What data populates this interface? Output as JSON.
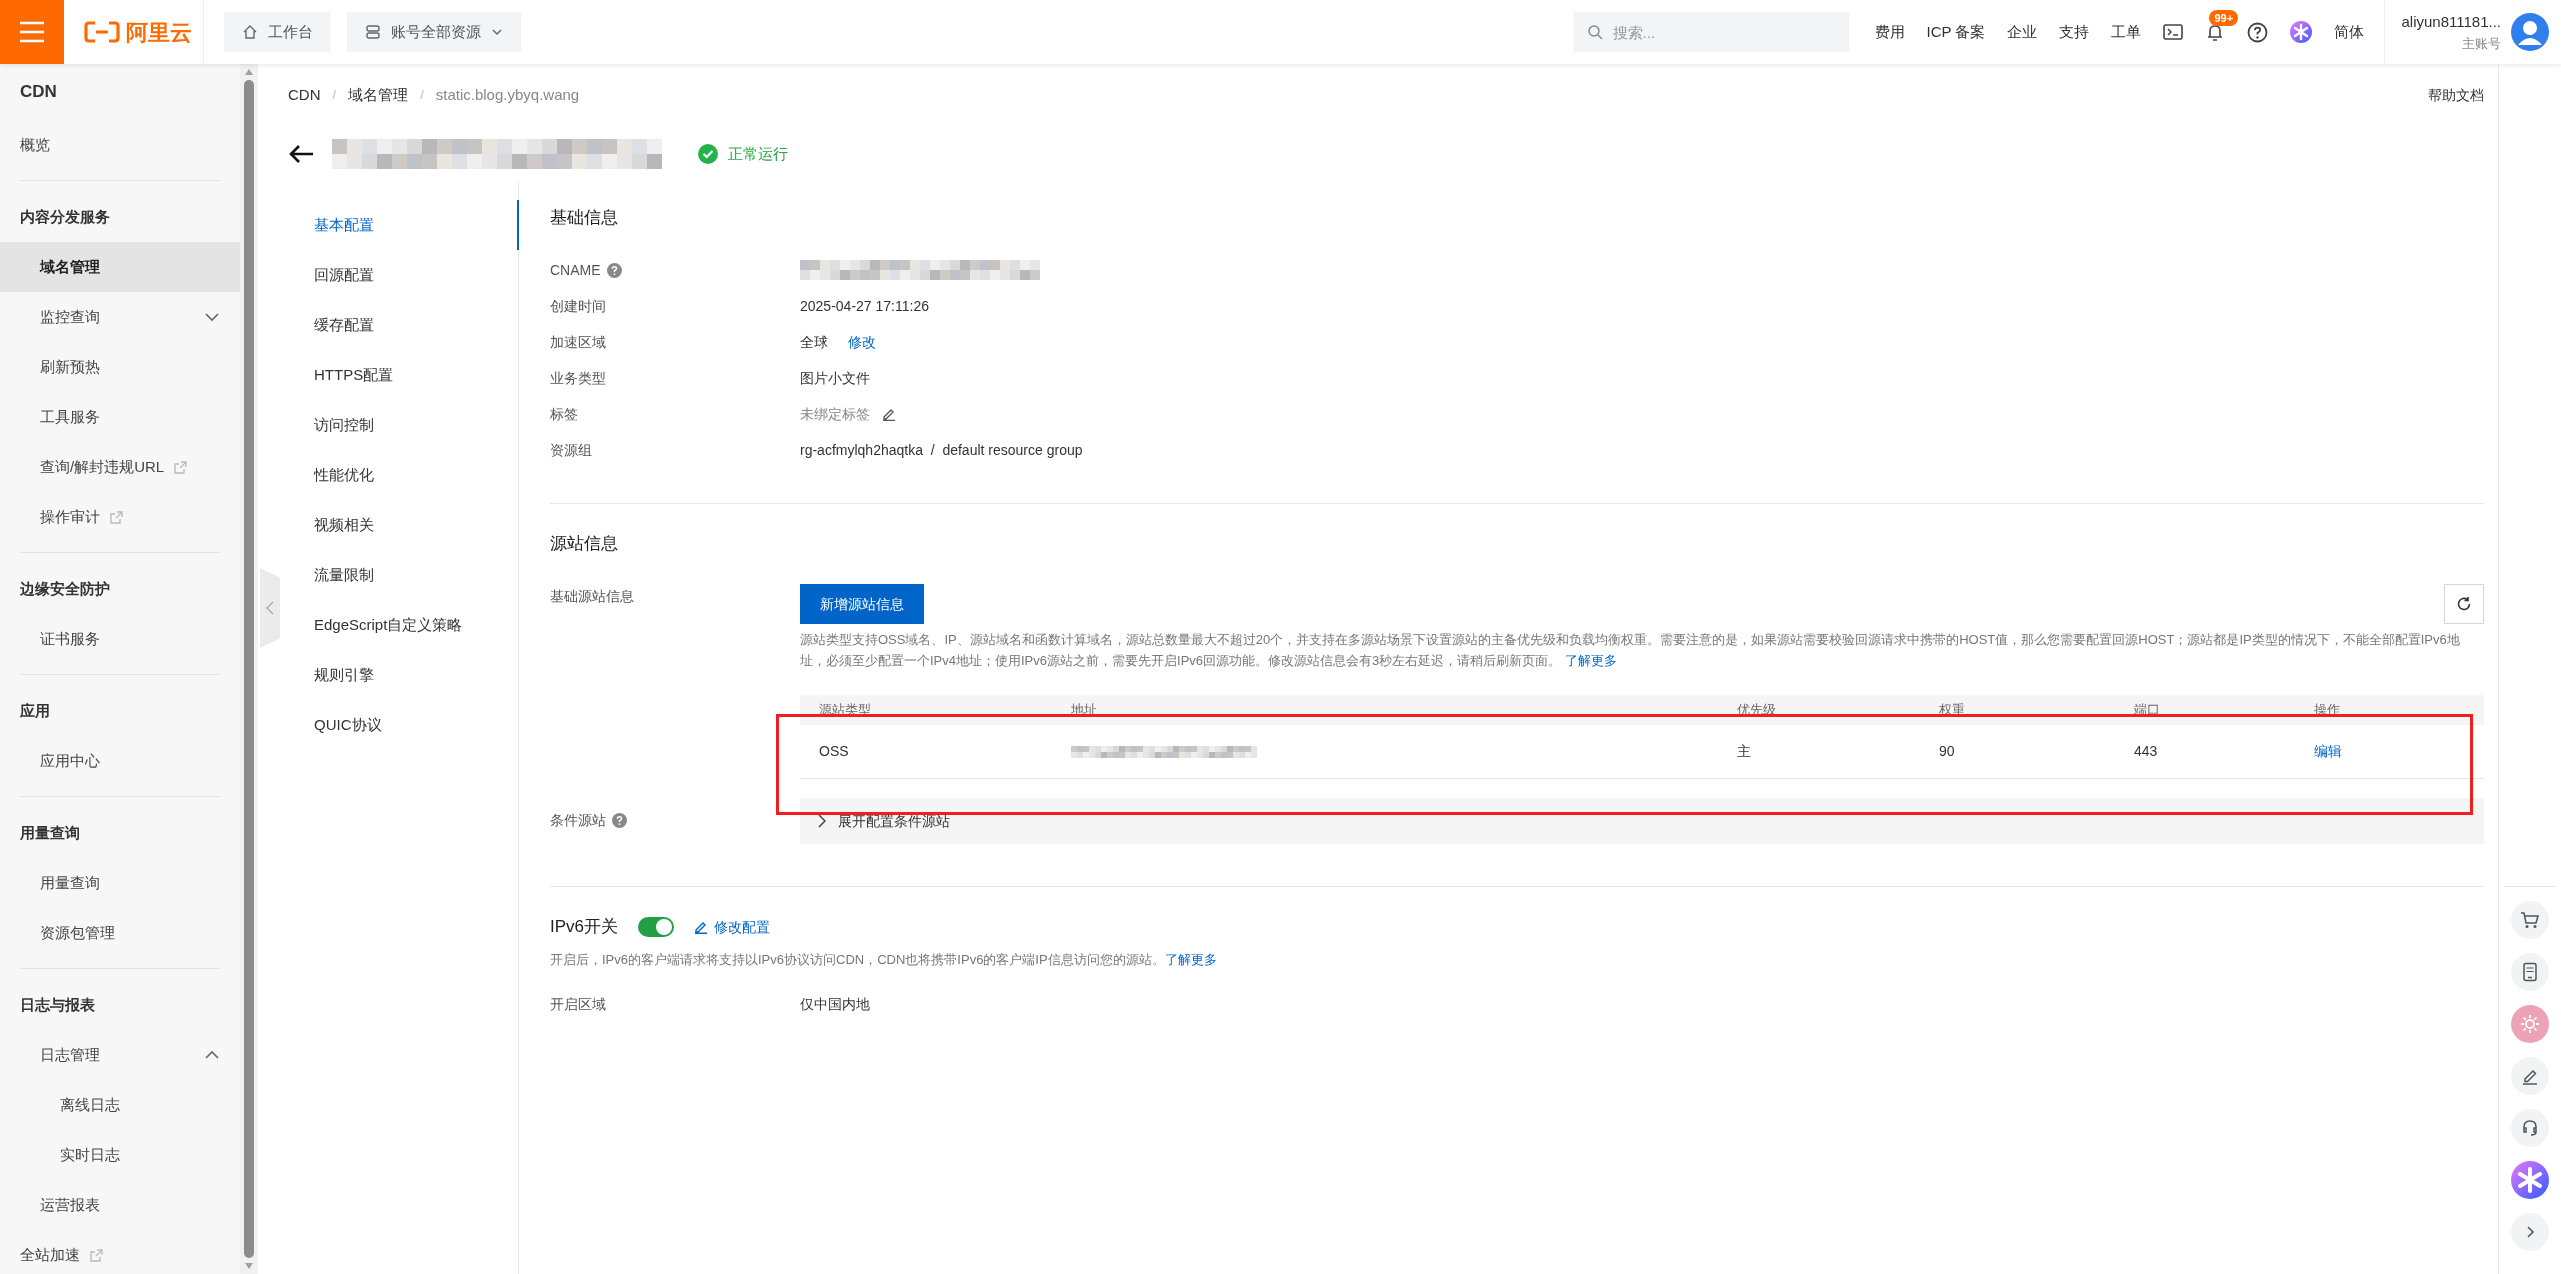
{
  "topbar": {
    "logo_text": "阿里云",
    "workbench": "工作台",
    "resources": "账号全部资源",
    "search": {
      "placeholder": "搜索..."
    },
    "links": [
      "费用",
      "ICP 备案",
      "企业",
      "支持",
      "工单"
    ],
    "notification_badge": "99+",
    "language": "简体",
    "user": {
      "name": "aliyun811181...",
      "role": "主账号"
    }
  },
  "sidebar": {
    "title": "CDN",
    "sections": [
      {
        "items": [
          {
            "label": "概览",
            "selected": false
          }
        ]
      },
      {
        "heading": "内容分发服务",
        "items": [
          {
            "label": "域名管理",
            "selected": true
          },
          {
            "label": "监控查询",
            "selected": false,
            "expanded": false
          },
          {
            "label": "刷新预热",
            "selected": false
          },
          {
            "label": "工具服务",
            "selected": false
          },
          {
            "label": "查询/解封违规URL",
            "selected": false,
            "external": true
          },
          {
            "label": "操作审计",
            "selected": false,
            "external": true
          }
        ]
      },
      {
        "heading": "边缘安全防护",
        "items": [
          {
            "label": "证书服务",
            "selected": false
          }
        ]
      },
      {
        "heading": "应用",
        "items": [
          {
            "label": "应用中心",
            "selected": false
          }
        ]
      },
      {
        "heading": "用量查询",
        "items": [
          {
            "label": "用量查询",
            "selected": false
          },
          {
            "label": "资源包管理",
            "selected": false
          }
        ]
      },
      {
        "heading": "日志与报表",
        "items": [
          {
            "label": "日志管理",
            "selected": false,
            "expanded": true,
            "children": [
              {
                "label": "离线日志",
                "selected": false
              },
              {
                "label": "实时日志",
                "selected": false
              }
            ]
          },
          {
            "label": "运营报表",
            "selected": false
          }
        ]
      },
      {
        "items": [
          {
            "label": "全站加速",
            "selected": false,
            "external": true
          }
        ]
      }
    ]
  },
  "breadcrumb": {
    "separator": "/",
    "items": [
      "CDN",
      "域名管理",
      "static.blog.ybyq.wang"
    ]
  },
  "help_link": "帮助文档",
  "header": {
    "title": {
      "kind": "redacted"
    },
    "status": "正常运行"
  },
  "config_nav": [
    {
      "label": "基本配置",
      "selected": true
    },
    {
      "label": "回源配置",
      "selected": false
    },
    {
      "label": "缓存配置",
      "selected": false
    },
    {
      "label": "HTTPS配置",
      "selected": false
    },
    {
      "label": "访问控制",
      "selected": false
    },
    {
      "label": "性能优化",
      "selected": false
    },
    {
      "label": "视频相关",
      "selected": false
    },
    {
      "label": "流量限制",
      "selected": false
    },
    {
      "label": "EdgeScript自定义策略",
      "selected": false
    },
    {
      "label": "规则引擎",
      "selected": false
    },
    {
      "label": "QUIC协议",
      "selected": false
    }
  ],
  "basic_info": {
    "title": "基础信息",
    "rows": [
      {
        "label": "CNAME",
        "help": true,
        "value": {
          "kind": "redacted"
        }
      },
      {
        "label": "创建时间",
        "value": {
          "kind": "text",
          "text": "2025-04-27 17:11:26"
        }
      },
      {
        "label": "加速区域",
        "value": {
          "kind": "text",
          "text": "全球"
        },
        "action": "修改"
      },
      {
        "label": "业务类型",
        "value": {
          "kind": "text",
          "text": "图片小文件"
        }
      },
      {
        "label": "标签",
        "value": {
          "kind": "muted",
          "text": "未绑定标签"
        },
        "editable": true
      },
      {
        "label": "资源组",
        "value": {
          "kind": "text",
          "text": "rg-acfmylqh2haqtka  /  default resource group"
        }
      }
    ]
  },
  "origin_info": {
    "title": "源站信息",
    "basic_label": "基础源站信息",
    "add_button": "新增源站信息",
    "description": "源站类型支持OSS域名、IP、源站域名和函数计算域名，源站总数量最大不超过20个，并支持在多源站场景下设置源站的主备优先级和负载均衡权重。需要注意的是，如果源站需要校验回源请求中携带的HOST值，那么您需要配置回源HOST；源站都是IP类型的情况下，不能全部配置IPv6地址，必须至少配置一个IPv4地址；使用IPv6源站之前，需要先开启IPv6回源功能。修改源站信息会有3秒左右延迟，请稍后刷新页面。",
    "learn_more": "了解更多",
    "table": {
      "highlighted": true,
      "columns": [
        "源站类型",
        "地址",
        "优先级",
        "权重",
        "端口",
        "操作"
      ],
      "rows": [
        {
          "type": "OSS",
          "address": {
            "kind": "redacted"
          },
          "priority": "主",
          "weight": "90",
          "port": "443",
          "action": "编辑"
        }
      ]
    },
    "conditional_label": "条件源站",
    "conditional_expand": "展开配置条件源站"
  },
  "ipv6": {
    "title": "IPv6开关",
    "on": true,
    "edit": "修改配置",
    "description": "开启后，IPv6的客户端请求将支持以IPv6协议访问CDN，CDN也将携带IPv6的客户端IP信息访问您的源站。",
    "learn_more": "了解更多",
    "region_label": "开启区域",
    "region_value": "仅中国内地"
  }
}
